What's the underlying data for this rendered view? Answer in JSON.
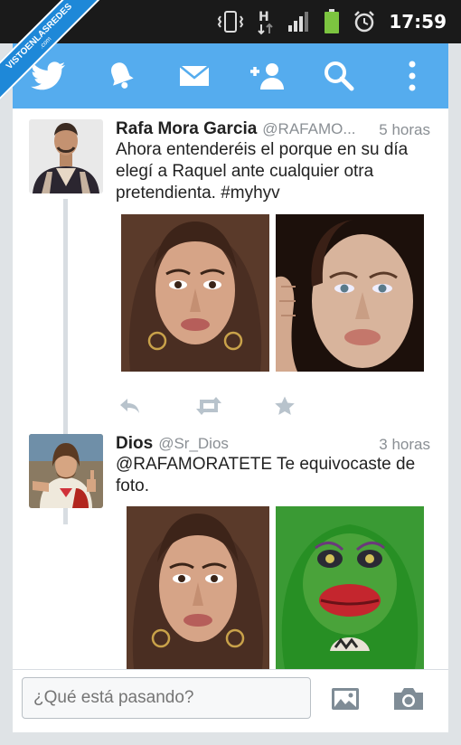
{
  "status_bar": {
    "time": "17:59",
    "network_label": "H",
    "icons": [
      "vibrate-icon",
      "network-h-icon",
      "signal-icon",
      "battery-icon",
      "alarm-icon"
    ]
  },
  "watermark": {
    "line1": "VISTOENLASREDES",
    "line2": ".com"
  },
  "nav": {
    "items": [
      "home-bird-icon",
      "notifications-bell-icon",
      "messages-envelope-icon",
      "add-user-icon",
      "search-icon",
      "overflow-menu-icon"
    ],
    "background": "#55acee"
  },
  "tweets": [
    {
      "name": "Rafa Mora Garcia",
      "handle": "@RAFAMO...",
      "time": "5 horas",
      "text": "Ahora entenderéis el porque en su día elegí a Raquel ante cualquier otra pretendienta. #myhyv",
      "actions": [
        "reply-icon",
        "retweet-icon",
        "favorite-star-icon"
      ]
    },
    {
      "name": "Dios",
      "handle": "@Sr_Dios",
      "time": "3 horas",
      "text": "@RAFAMORATETE Te equivocaste de foto."
    }
  ],
  "composer": {
    "placeholder": "¿Qué está pasando?",
    "icons": [
      "photo-gallery-icon",
      "camera-icon"
    ]
  },
  "colors": {
    "accent": "#55acee",
    "action_icon": "#b8c3cc",
    "name_text": "#222222",
    "meta_text": "#8a8f94"
  }
}
